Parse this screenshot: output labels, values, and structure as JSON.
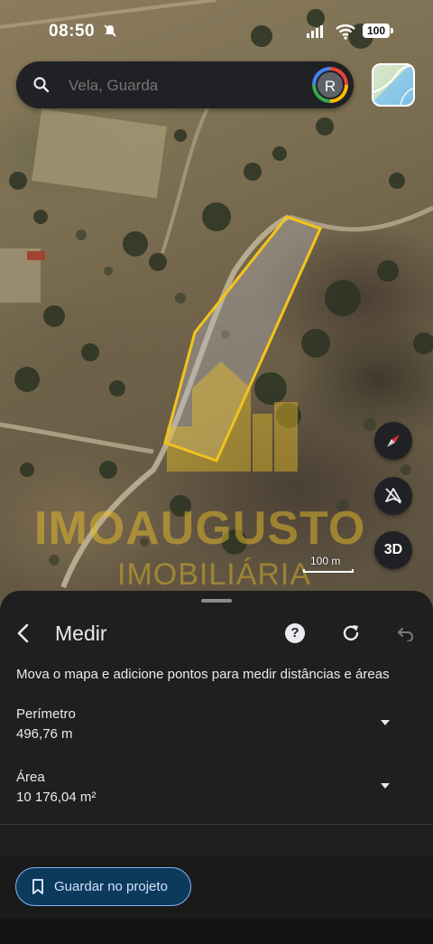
{
  "status_bar": {
    "time": "08:50",
    "battery": "100"
  },
  "search": {
    "placeholder": "Vela, Guarda",
    "avatar_initial": "R"
  },
  "map": {
    "scale_label": "100 m",
    "btn_3d": "3D",
    "watermark": {
      "line1": "IMOAUGUSTO",
      "line2": "IMOBILIÁRIA"
    },
    "polygon_color": "#f5c518"
  },
  "sheet": {
    "title": "Medir",
    "instructions": "Mova o mapa e adicione pontos para medir distâncias e áreas",
    "perimeter": {
      "label": "Perímetro",
      "value": "496,76 m"
    },
    "area": {
      "label": "Área",
      "value": "10 176,04 m²"
    },
    "save_label": "Guardar no projeto"
  },
  "icons": [
    "search-icon",
    "layers-thumbnail",
    "compass-icon",
    "tilt-icon",
    "back-arrow-icon",
    "help-icon",
    "refresh-icon",
    "undo-icon",
    "chevron-down-icon",
    "bookmark-icon"
  ]
}
